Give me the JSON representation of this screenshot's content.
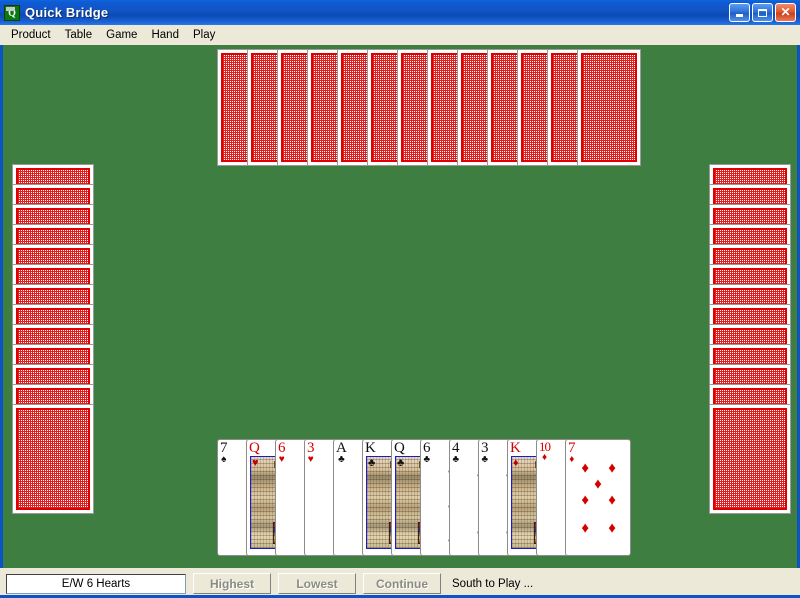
{
  "window": {
    "title": "Quick Bridge",
    "icon": "quick-bridge-icon",
    "icon_glyph": "Q",
    "minimize_label": "",
    "maximize_label": "",
    "close_label": "✕",
    "titlebar_color": "#0d4ab4",
    "felt_color": "#3e7f41"
  },
  "menu": {
    "items": [
      {
        "label": "Product"
      },
      {
        "label": "Table"
      },
      {
        "label": "Game"
      },
      {
        "label": "Hand"
      },
      {
        "label": "Play"
      }
    ]
  },
  "table": {
    "card_back_color": "#e00000",
    "hands": {
      "north": {
        "name": "north-hand",
        "card_count": 13,
        "face_up": false
      },
      "west": {
        "name": "west-hand",
        "card_count": 13,
        "face_up": false
      },
      "east": {
        "name": "east-hand",
        "card_count": 13,
        "face_up": false
      },
      "south": {
        "name": "south-hand",
        "face_up": true,
        "card_count": 13,
        "cards": [
          {
            "rank": "7",
            "suit": "spades",
            "suit_symbol": "♠",
            "color": "black",
            "court": false,
            "pips": 3
          },
          {
            "rank": "Q",
            "suit": "hearts",
            "suit_symbol": "♥",
            "color": "red",
            "court": true,
            "pips": 0
          },
          {
            "rank": "6",
            "suit": "hearts",
            "suit_symbol": "♥",
            "color": "red",
            "court": false,
            "pips": 3
          },
          {
            "rank": "3",
            "suit": "hearts",
            "suit_symbol": "♥",
            "color": "red",
            "court": false,
            "pips": 2
          },
          {
            "rank": "A",
            "suit": "clubs",
            "suit_symbol": "♣",
            "color": "black",
            "court": false,
            "pips": 0
          },
          {
            "rank": "K",
            "suit": "clubs",
            "suit_symbol": "♣",
            "color": "black",
            "court": true,
            "pips": 0
          },
          {
            "rank": "Q",
            "suit": "clubs",
            "suit_symbol": "♣",
            "color": "black",
            "court": true,
            "pips": 0
          },
          {
            "rank": "6",
            "suit": "clubs",
            "suit_symbol": "♣",
            "color": "black",
            "court": false,
            "pips": 3
          },
          {
            "rank": "4",
            "suit": "clubs",
            "suit_symbol": "♣",
            "color": "black",
            "court": false,
            "pips": 2
          },
          {
            "rank": "3",
            "suit": "clubs",
            "suit_symbol": "♣",
            "color": "black",
            "court": false,
            "pips": 2
          },
          {
            "rank": "K",
            "suit": "diamonds",
            "suit_symbol": "♦",
            "color": "red",
            "court": true,
            "pips": 0
          },
          {
            "rank": "10",
            "suit": "diamonds",
            "suit_symbol": "♦",
            "color": "red",
            "court": false,
            "pips": 4
          },
          {
            "rank": "7",
            "suit": "diamonds",
            "suit_symbol": "♦",
            "color": "red",
            "court": false,
            "pips": 7
          }
        ]
      }
    }
  },
  "statusbar": {
    "contract": "E/W 6 Hearts",
    "buttons": [
      {
        "label": "Highest",
        "name": "highest-button",
        "enabled": false
      },
      {
        "label": "Lowest",
        "name": "lowest-button",
        "enabled": false
      },
      {
        "label": "Continue",
        "name": "continue-button",
        "enabled": false
      }
    ],
    "status_text": "South to Play ..."
  }
}
